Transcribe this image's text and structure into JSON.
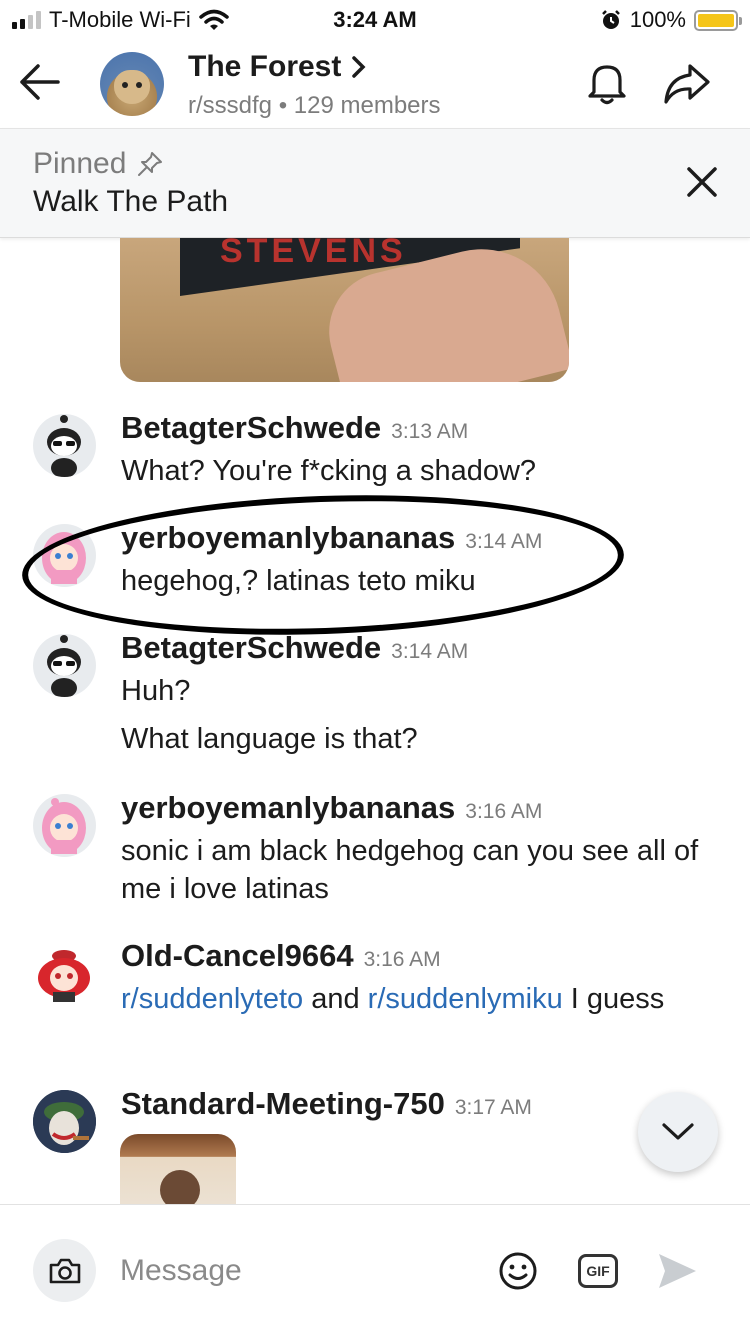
{
  "status_bar": {
    "carrier": "T-Mobile Wi-Fi",
    "time": "3:24 AM",
    "battery": "100%"
  },
  "header": {
    "title": "The Forest",
    "subreddit": "r/sssdfg",
    "members": "129 members"
  },
  "pinned": {
    "label": "Pinned",
    "text": "Walk The Path"
  },
  "messages": [
    {
      "user": "BetagterSchwede",
      "time": "3:13 AM",
      "lines": [
        "What? You're f*cking a shadow?"
      ]
    },
    {
      "user": "yerboyemanlybananas",
      "time": "3:14 AM",
      "lines": [
        "hegehog,? latinas teto miku"
      ]
    },
    {
      "user": "BetagterSchwede",
      "time": "3:14 AM",
      "lines": [
        "Huh?",
        "What language is that?"
      ]
    },
    {
      "user": "yerboyemanlybananas",
      "time": "3:16 AM",
      "lines": [
        "sonic i am black hedgehog can you see all of me i love latinas"
      ]
    },
    {
      "user": "Old-Cancel9664",
      "time": "3:16 AM",
      "link1": "r/suddenlyteto",
      "middle": " and ",
      "link2": "r/suddenlymiku",
      "tail": " I guess"
    },
    {
      "user": "Standard-Meeting-750",
      "time": "3:17 AM"
    }
  ],
  "images": {
    "book_title": "STEVENS"
  },
  "composer": {
    "placeholder": "Message",
    "gif_label": "GIF"
  },
  "colors": {
    "link": "#2a6bb5",
    "battery": "#f5c518",
    "muted": "#7c7c7c"
  },
  "icons": [
    "back-arrow-icon",
    "bell-icon",
    "share-icon",
    "pin-icon",
    "close-icon",
    "chevron-down-icon",
    "camera-icon",
    "emoji-icon",
    "gif-icon",
    "send-icon",
    "wifi-icon",
    "alarm-icon"
  ]
}
